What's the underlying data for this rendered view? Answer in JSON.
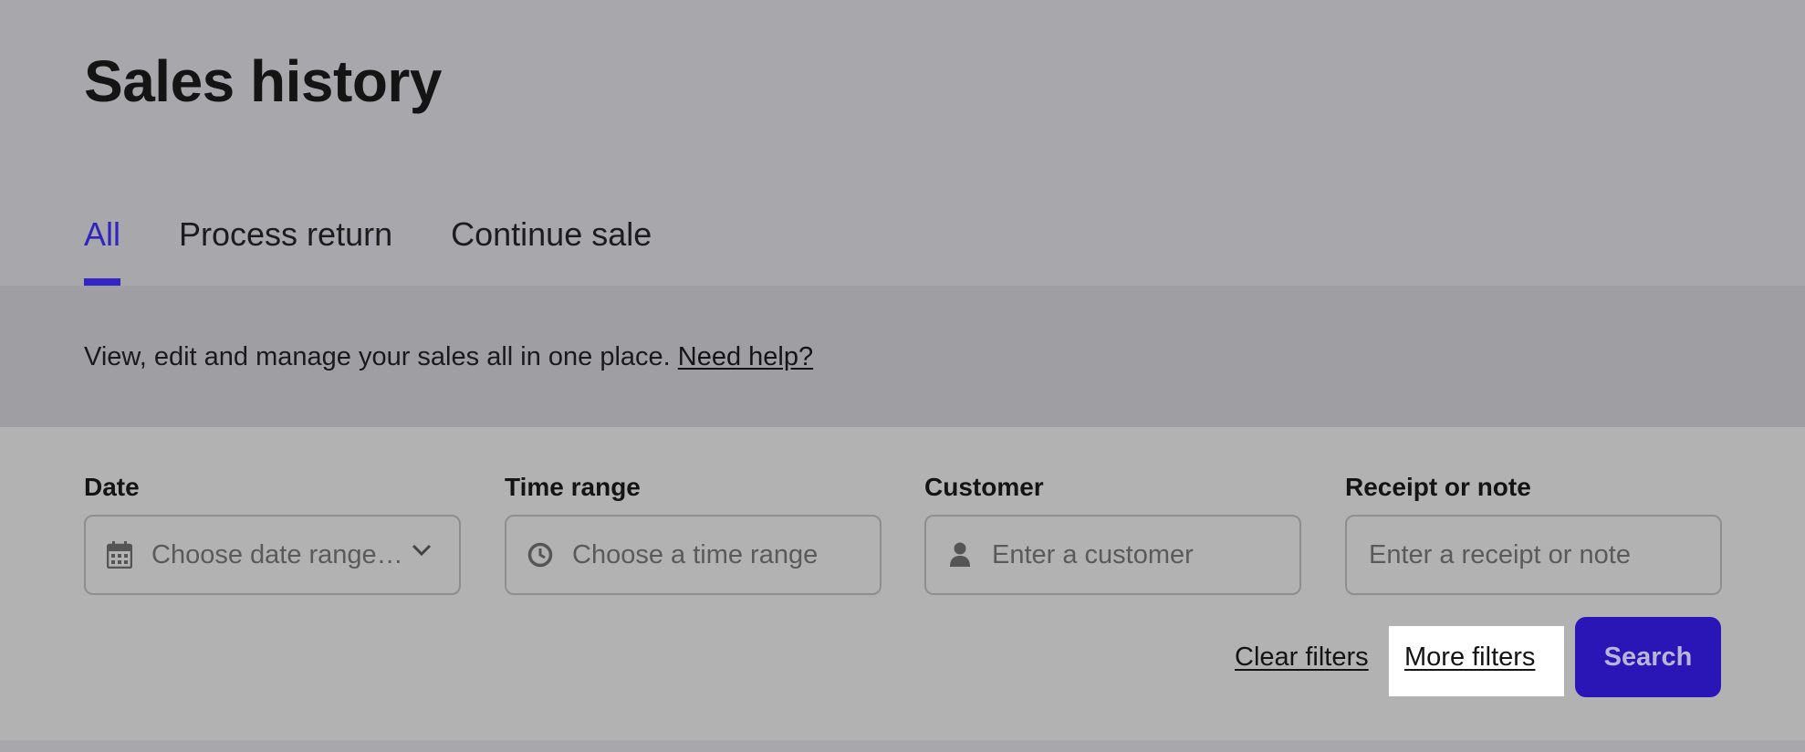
{
  "page": {
    "title": "Sales history"
  },
  "tabs": [
    {
      "label": "All",
      "active": true
    },
    {
      "label": "Process return",
      "active": false
    },
    {
      "label": "Continue sale",
      "active": false
    }
  ],
  "info": {
    "text": "View, edit and manage your sales all in one place.",
    "help_link": "Need help?"
  },
  "filters": {
    "date": {
      "label": "Date",
      "placeholder": "Choose date range…",
      "icon": "calendar-icon"
    },
    "time_range": {
      "label": "Time range",
      "placeholder": "Choose a time range",
      "icon": "clock-icon"
    },
    "customer": {
      "label": "Customer",
      "placeholder": "Enter a customer",
      "icon": "person-icon"
    },
    "receipt": {
      "label": "Receipt or note",
      "placeholder": "Enter a receipt or note"
    }
  },
  "actions": {
    "clear_filters": "Clear filters",
    "more_filters": "More filters",
    "search": "Search"
  },
  "colors": {
    "accent": "#3326c5",
    "search_button": "#2a16b6"
  }
}
